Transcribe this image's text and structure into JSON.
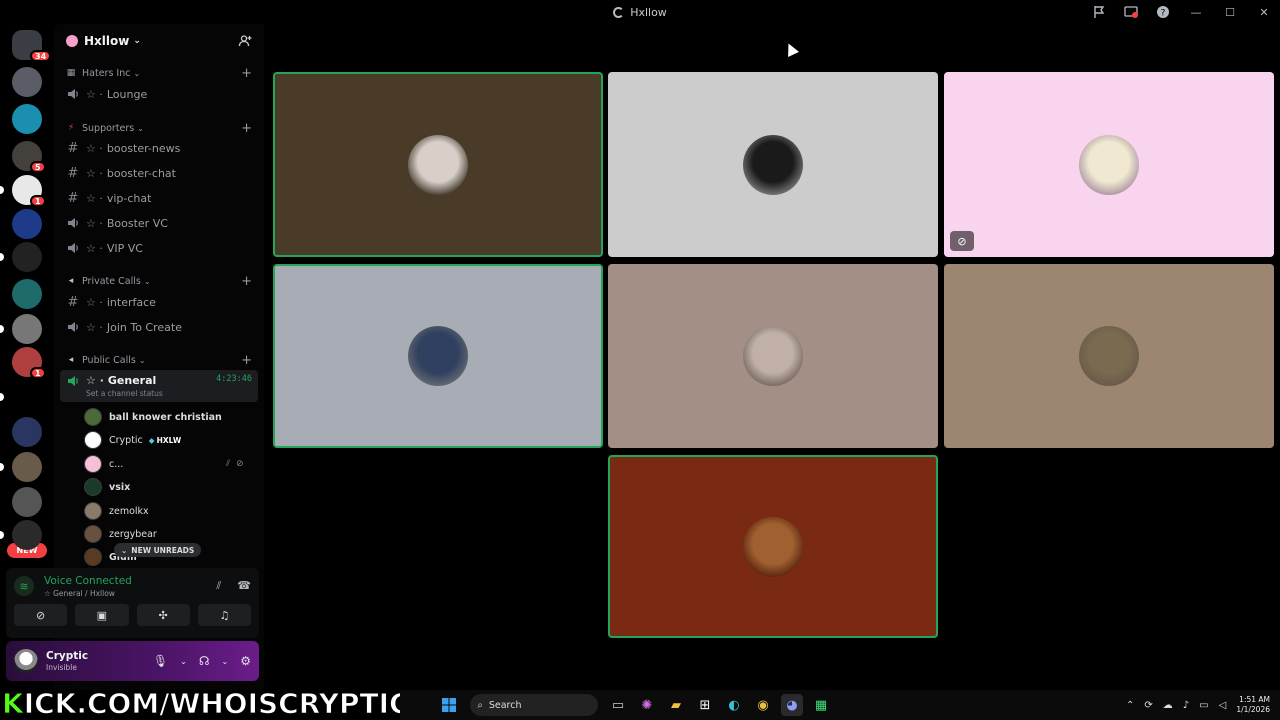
{
  "window": {
    "title": "Hxllow"
  },
  "rail": {
    "servers": [
      {
        "name": "Discord home",
        "badge": "34",
        "color": "#3a3d44"
      },
      {
        "name": "server-2",
        "badge": "",
        "color": "#5a5d66"
      },
      {
        "name": "server-ny",
        "badge": "",
        "color": "#1b8fb0"
      },
      {
        "name": "server-4",
        "badge": "5",
        "color": "#44403c"
      },
      {
        "name": "server-5",
        "badge": "1",
        "color": "#e8e8e8"
      },
      {
        "name": "server-6",
        "badge": "",
        "color": "#1e3a8a"
      },
      {
        "name": "server-7",
        "badge": "",
        "color": "#222"
      },
      {
        "name": "server-8",
        "badge": "",
        "color": "#1f6b6b"
      },
      {
        "name": "server-9",
        "badge": "",
        "color": "#777"
      },
      {
        "name": "server-10",
        "badge": "1",
        "color": "#b04040"
      },
      {
        "name": "kick",
        "badge": "",
        "color": "#000"
      },
      {
        "name": "server-12",
        "badge": "",
        "color": "#2a3560"
      },
      {
        "name": "server-13",
        "badge": "",
        "color": "#6a5a4a"
      },
      {
        "name": "server-14",
        "badge": "",
        "color": "#555"
      },
      {
        "name": "server-15",
        "badge": "",
        "color": "#2a2a2a"
      }
    ],
    "new_label": "NEW"
  },
  "guild": {
    "name": "Hxllow"
  },
  "sidebar": {
    "categories": [
      {
        "label": "Haters Inc"
      },
      {
        "label": "Supporters"
      },
      {
        "label": "Private Calls"
      },
      {
        "label": "Public Calls"
      }
    ],
    "channels": [
      {
        "label": "Lounge",
        "type": "voice"
      },
      {
        "label": "booster-news",
        "type": "text"
      },
      {
        "label": "booster-chat",
        "type": "text"
      },
      {
        "label": "vip-chat",
        "type": "text"
      },
      {
        "label": "Booster VC",
        "type": "voice"
      },
      {
        "label": "VIP VC",
        "type": "voice"
      },
      {
        "label": "interface",
        "type": "text"
      },
      {
        "label": "Join To Create",
        "type": "voice"
      }
    ],
    "active_channel": {
      "label": "General",
      "timer": "4:23:46",
      "status_hint": "Set a channel status"
    },
    "voice_users": [
      {
        "name": "ball knower christian",
        "bold": true,
        "avatar_color": "#4a6a3a"
      },
      {
        "name": "Cryptic",
        "bold": false,
        "tag": "HXLW",
        "avatar_color": "#ffffff"
      },
      {
        "name": "c...",
        "bold": false,
        "avatar_color": "#f4c0d8"
      },
      {
        "name": "vsix",
        "bold": true,
        "avatar_color": "#1a3a2a"
      },
      {
        "name": "zemolkx",
        "bold": false,
        "avatar_color": "#8a7a6a"
      },
      {
        "name": "zergybear",
        "bold": false,
        "avatar_color": "#6a5040"
      },
      {
        "name": "Glum",
        "bold": true,
        "avatar_color": "#5a3a20"
      }
    ],
    "new_unreads": "NEW UNREADS"
  },
  "voice_panel": {
    "title": "Voice Connected",
    "subtitle": "General / Hxllow"
  },
  "user_panel": {
    "name": "Cryptic",
    "status": "Invisible"
  },
  "tiles": [
    {
      "bg": "#4a3a28",
      "speaking": true,
      "avatar": "#d8d0c8",
      "video_off": false
    },
    {
      "bg": "#cccccc",
      "speaking": false,
      "avatar": "#1a1a1a",
      "video_off": false
    },
    {
      "bg": "#f8d4ee",
      "speaking": false,
      "avatar": "#f0e8d0",
      "video_off": true
    },
    {
      "bg": "#a8acb4",
      "speaking": true,
      "avatar": "#304060",
      "video_off": false
    },
    {
      "bg": "#a38f86",
      "speaking": false,
      "avatar": "#c0b0a8",
      "video_off": false
    },
    {
      "bg": "#9c8672",
      "speaking": false,
      "avatar": "#7a6a50",
      "video_off": false
    },
    {
      "bg": "#7a2a12",
      "speaking": true,
      "avatar": "#a06030",
      "video_off": false
    }
  ],
  "overlay": {
    "prefix": "K",
    "text": "ICK.COM/WHOISCRYPTIC"
  },
  "taskbar": {
    "search_placeholder": "Search",
    "time": "1:51 AM",
    "date": "1/1/2026"
  }
}
